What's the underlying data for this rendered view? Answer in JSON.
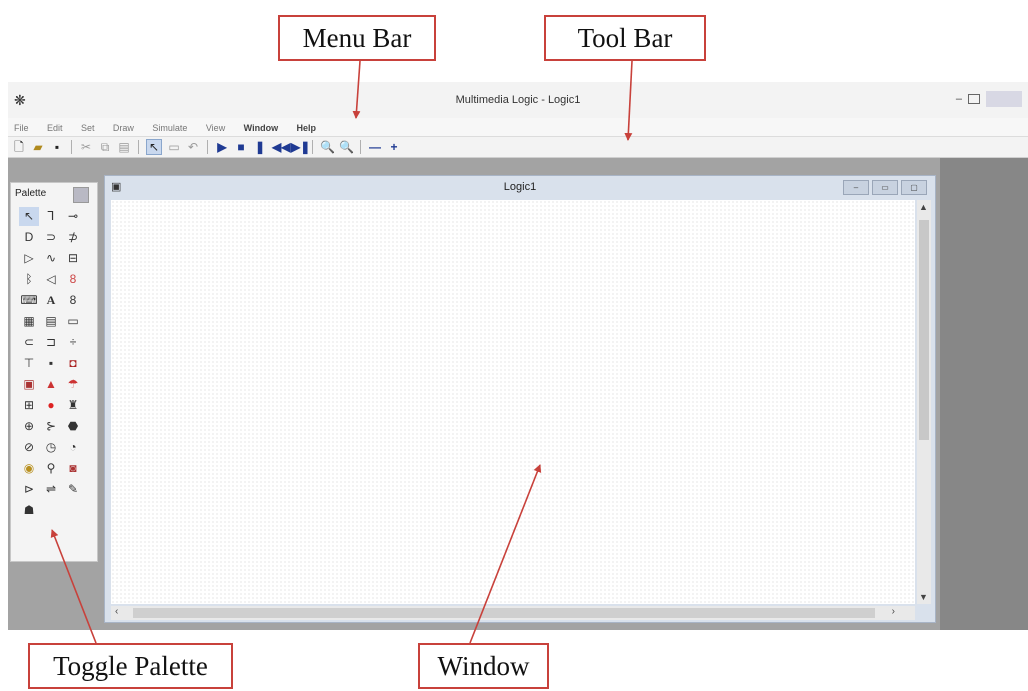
{
  "callouts": {
    "menu_bar": "Menu Bar",
    "tool_bar": "Tool Bar",
    "toggle_palette": "Toggle Palette",
    "window": "Window"
  },
  "app": {
    "title": "Multimedia Logic - Logic1",
    "icon": "app-logo-icon",
    "window_controls": [
      "–",
      "▭",
      "✕"
    ]
  },
  "menu": {
    "items": [
      "File",
      "Edit",
      "Set",
      "Draw",
      "Simulate",
      "View",
      "Window",
      "Help"
    ]
  },
  "toolbar": {
    "buttons": [
      "new-icon",
      "open-icon",
      "save-icon",
      "cut-icon",
      "copy-icon",
      "paste-icon",
      "select-icon",
      "rectangle-icon",
      "undo-icon",
      "play-icon",
      "stop-icon",
      "pause-icon",
      "rewind-icon",
      "step-icon",
      "zoom-in-icon",
      "zoom-out-icon",
      "minus-icon",
      "plus-icon"
    ]
  },
  "palette": {
    "title": "Palette"
  },
  "child_window": {
    "title": "Logic1"
  },
  "colors": {
    "callout_border": "#c8413b",
    "arrow": "#c8413b",
    "workspace": "#a3a3a3"
  }
}
